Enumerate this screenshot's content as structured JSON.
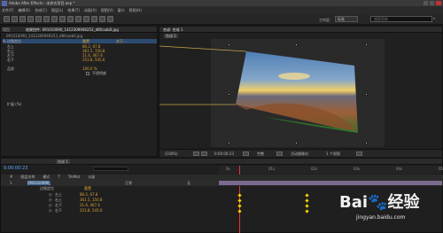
{
  "app": {
    "title": "Adobe After Effects - 未命名项目.aep *",
    "menus": [
      "文件(F)",
      "编辑(E)",
      "合成(C)",
      "图层(L)",
      "效果(T)",
      "动画(A)",
      "视图(V)",
      "窗口",
      "帮助(H)"
    ],
    "workspace_label": "工作区:",
    "workspace_value": "标准",
    "search_placeholder": "搜索帮助"
  },
  "effect_panel": {
    "tab_label": "项目",
    "tab2_label": "效果控件: 091010090_1412309949253_d8fcaab0.jpg",
    "file_label": "091010090_1412309949253_d8fcaab0.jpg",
    "effect_name": "fx 边角定位",
    "reset_label": "重置",
    "about_label": "关于...",
    "properties": [
      {
        "name": "左上",
        "value": "86.2, 67.8"
      },
      {
        "name": "右上",
        "value": "361.5, 150.8"
      },
      {
        "name": "左下",
        "value": "21.6, 467.6"
      },
      {
        "name": "右下",
        "value": "253.8, 545.6"
      }
    ],
    "quality_label": "品质",
    "quality_value": "100.0 %",
    "motion_blur_label": "运动模糊",
    "motion_blur_value": "不透明度",
    "extend_label": "扩展 (%)"
  },
  "composition": {
    "tab_label": "合成: 合成 1",
    "subtab": "合成 1",
    "zoom": "(100%)",
    "timecode": "0:00:00:23",
    "resolution": "完整",
    "camera": "活动摄像机",
    "view": "1 个视图"
  },
  "timeline": {
    "timecode": "0:00:00:23",
    "tab_label": "合成 1",
    "search_placeholder": "",
    "layer_columns": [
      "#",
      "图层名称",
      "模式",
      "T",
      "TrkMat",
      "父级"
    ],
    "layer": {
      "index": "1",
      "name": "[091010090_...]",
      "mode": "正常",
      "parent": "无"
    },
    "effect_row": "边角定位",
    "reset_label": "重置",
    "properties": [
      {
        "name": "左上",
        "value": "86.2, 67.8"
      },
      {
        "name": "右上",
        "value": "361.5, 150.8"
      },
      {
        "name": "左下",
        "value": "21.6, 467.6"
      },
      {
        "name": "右下",
        "value": "253.8, 545.6"
      }
    ],
    "ruler_marks": [
      "0s",
      "01s",
      "02s",
      "03s",
      "04s",
      "05s"
    ]
  },
  "watermark": {
    "brand": "Bai",
    "brand2": "经验",
    "url": "jingyan.baidu.com"
  },
  "colors": {
    "accent_orange": "#d9a336",
    "accent_blue": "#5ea7ff",
    "keyframe_yellow": "#f0d000",
    "motion_path": "#c8a64a"
  }
}
